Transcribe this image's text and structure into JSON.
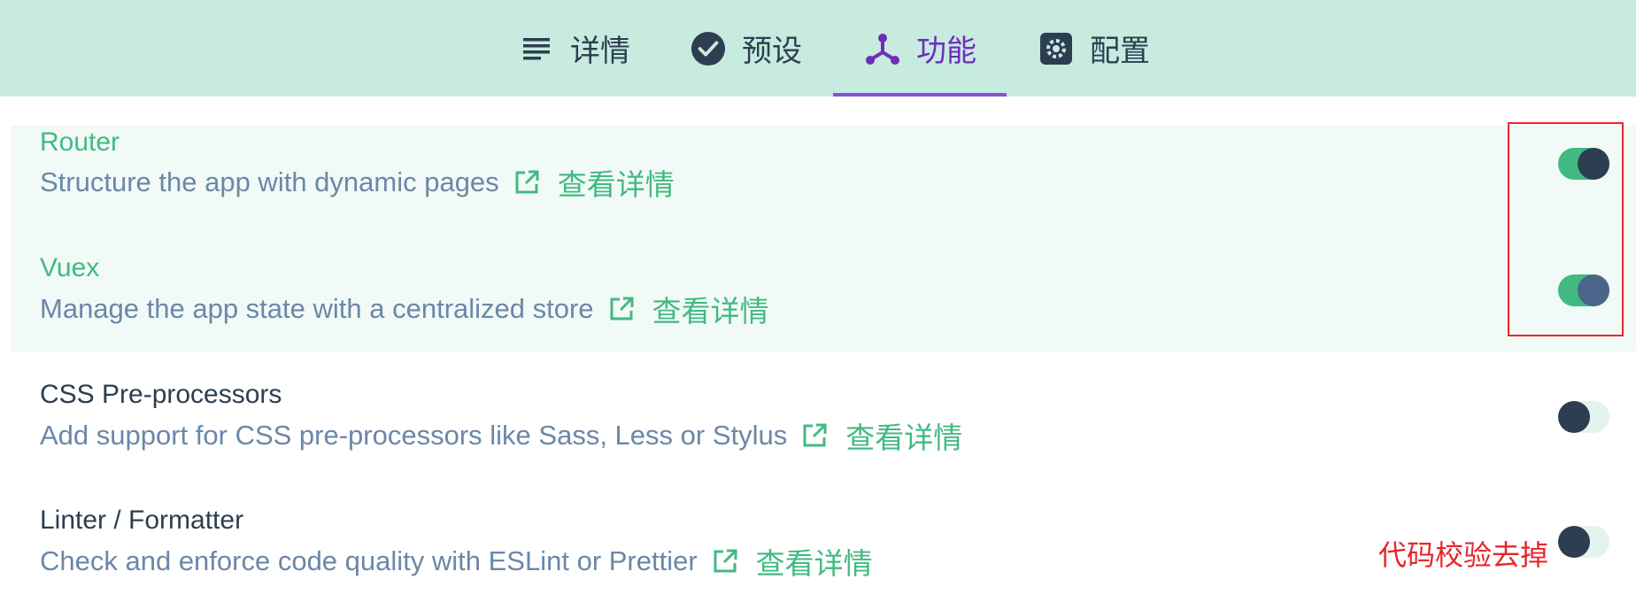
{
  "tabs": [
    {
      "label": "详情",
      "icon": "details-list-icon",
      "active": false
    },
    {
      "label": "预设",
      "icon": "check-circle-icon",
      "active": false
    },
    {
      "label": "功能",
      "icon": "features-fork-icon",
      "active": true
    },
    {
      "label": "配置",
      "icon": "gear-icon",
      "active": false
    }
  ],
  "features": [
    {
      "name": "Router",
      "description": "Structure the app with dynamic pages",
      "more_label": "查看详情",
      "enabled": true
    },
    {
      "name": "Vuex",
      "description": "Manage the app state with a centralized store",
      "more_label": "查看详情",
      "enabled": true
    },
    {
      "name": "CSS Pre-processors",
      "description": "Add support for CSS pre-processors like Sass, Less or Stylus",
      "more_label": "查看详情",
      "enabled": false
    },
    {
      "name": "Linter / Formatter",
      "description": "Check and enforce code quality with ESLint or Prettier",
      "more_label": "查看详情",
      "enabled": false
    }
  ],
  "annotation": {
    "text": "代码校验去掉",
    "color": "#e8262a"
  },
  "colors": {
    "topbar": "#c7ebdf",
    "accent_green": "#42b983",
    "active_tab": "#6f2dbd",
    "dark_text": "#2c3e50",
    "description_text": "#6b87a9"
  }
}
